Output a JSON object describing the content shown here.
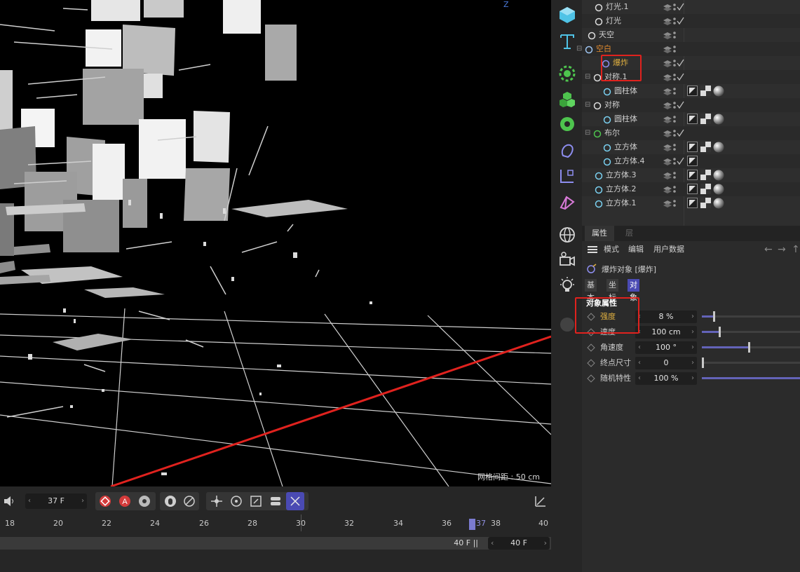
{
  "viewport": {
    "axis_label": "Z",
    "grid_spacing_label": "网格间距 : 50 cm"
  },
  "timeline": {
    "current_frame": "37 F",
    "ruler_labels": [
      "18",
      "20",
      "22",
      "24",
      "26",
      "28",
      "30",
      "32",
      "34",
      "36",
      "37",
      "38",
      "40"
    ],
    "end_frame": "40 F",
    "range_end_field": "40 F",
    "record_icon_letter": "A"
  },
  "object_manager": {
    "rows": [
      {
        "name": "灯光.1",
        "icon": "light-icon"
      },
      {
        "name": "灯光",
        "icon": "spotlight-icon"
      },
      {
        "name": "天空",
        "icon": "sky-icon"
      },
      {
        "name": "空白",
        "icon": "null-icon"
      },
      {
        "name": "爆炸",
        "icon": "explode-icon"
      },
      {
        "name": "对称.1",
        "icon": "symmetry-icon"
      },
      {
        "name": "圆柱体",
        "icon": "cylinder-icon"
      },
      {
        "name": "对称",
        "icon": "symmetry-icon"
      },
      {
        "name": "圆柱体",
        "icon": "cylinder-icon"
      },
      {
        "name": "布尔",
        "icon": "boole-icon"
      },
      {
        "name": "立方体",
        "icon": "cube-icon"
      },
      {
        "name": "立方体.4",
        "icon": "cube-icon"
      },
      {
        "name": "立方体.3",
        "icon": "cube-icon"
      },
      {
        "name": "立方体.2",
        "icon": "cube-icon"
      },
      {
        "name": "立方体.1",
        "icon": "cube-icon"
      }
    ]
  },
  "attributes": {
    "tabs": [
      "属性",
      "层"
    ],
    "menu": [
      "模式",
      "编辑",
      "用户数据"
    ],
    "object_title": "爆炸对象 [爆炸]",
    "subtabs": [
      "基本",
      "坐标",
      "对象"
    ],
    "active_subtab": "对象",
    "section_title": "对象属性",
    "params": [
      {
        "label": "强度",
        "value": "8 %",
        "fraction": 0.12
      },
      {
        "label": "速度",
        "value": "100 cm",
        "fraction": 0.18
      },
      {
        "label": "角速度",
        "value": "100 °",
        "fraction": 0.48
      },
      {
        "label": "终点尺寸",
        "value": "0",
        "fraction": 0.0
      },
      {
        "label": "随机特性",
        "value": "100 %",
        "fraction": 1.0
      }
    ]
  },
  "colors": {
    "accent": "#6363b8",
    "annotation_red": "#e0221e",
    "highlight_text": "#e0b040"
  }
}
